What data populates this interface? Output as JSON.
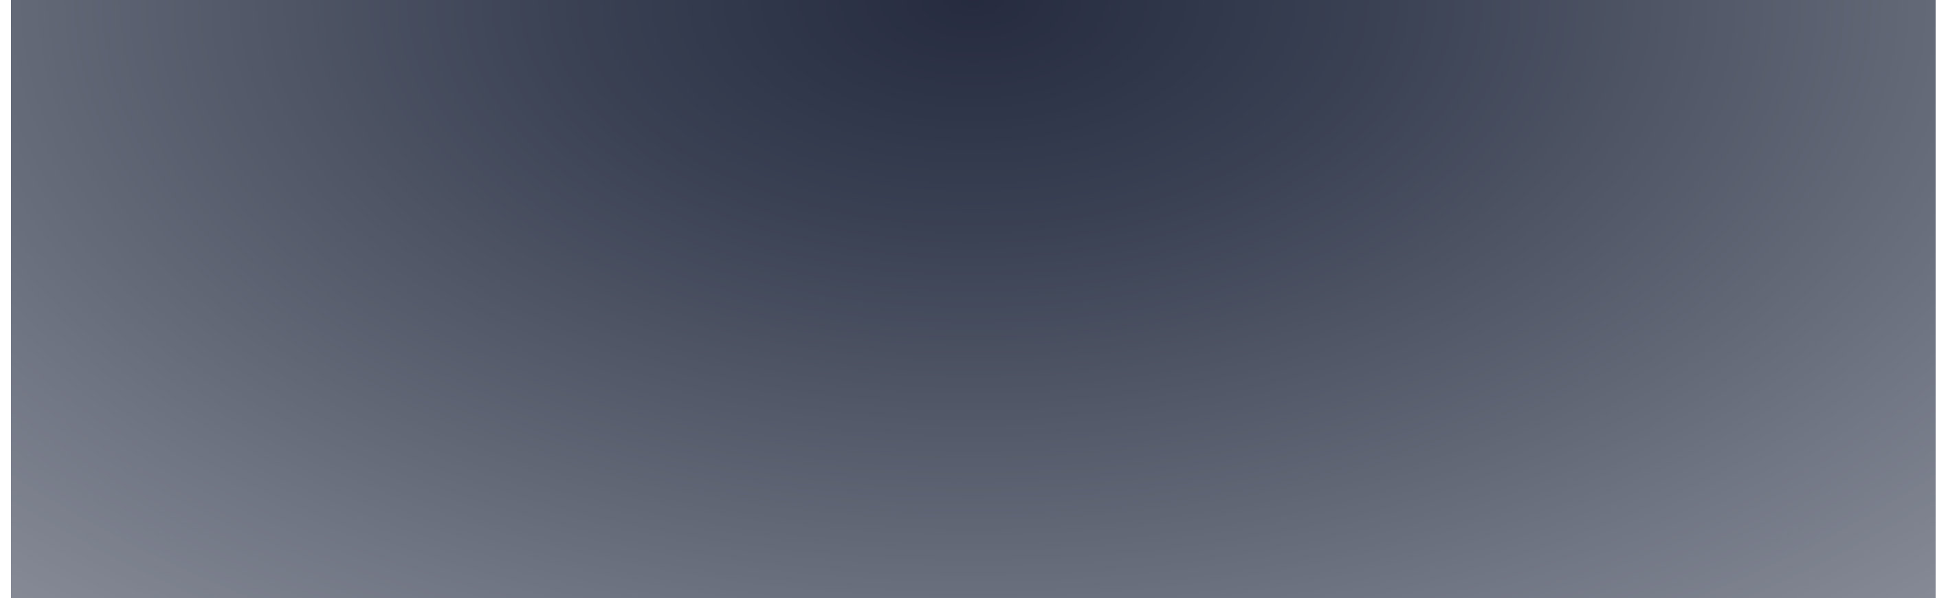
{
  "screen": {
    "background": {
      "type": "radial-gradient",
      "colors": [
        "#262b40",
        "#3a4153",
        "#555b6a",
        "#717684",
        "#8b8f9a",
        "#a1a4ad"
      ]
    },
    "frame_color": "#ffffff"
  }
}
